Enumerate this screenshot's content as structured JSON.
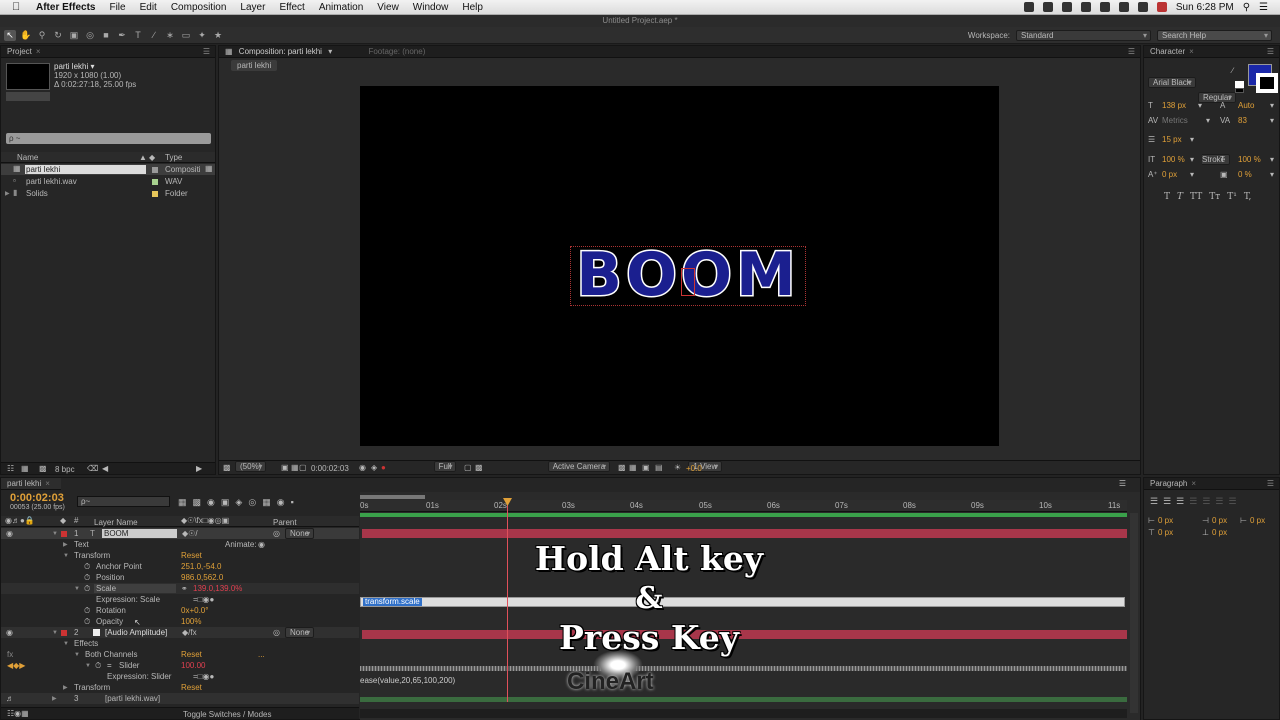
{
  "menubar": {
    "apple": "",
    "app": "After Effects",
    "items": [
      "File",
      "Edit",
      "Composition",
      "Layer",
      "Effect",
      "Animation",
      "View",
      "Window",
      "Help"
    ],
    "clock": "Sun 6:28 PM"
  },
  "title": "Untitled Project.aep *",
  "workspace": {
    "label": "Workspace:",
    "value": "Standard"
  },
  "search_help": "Search Help",
  "project": {
    "tab": "Project",
    "comp_name": "parti lekhi ▾",
    "comp_res": "1920 x 1080 (1.00)",
    "comp_dur": "Δ 0:02:27:18, 25.00 fps",
    "search_placeholder": "ρ ~",
    "col_name": "Name",
    "col_type": "Type",
    "items": [
      {
        "name": "parti lekhi",
        "type": "Compositi"
      },
      {
        "name": "parti lekhi.wav",
        "type": "WAV"
      },
      {
        "name": "Solids",
        "type": "Folder"
      }
    ],
    "bpc": "8 bpc"
  },
  "composition": {
    "tab": "Composition: parti lekhi",
    "footage": "Footage: (none)",
    "subtab": "parti lekhi",
    "text": "BOOM",
    "zoom": "(50%)",
    "timecode": "0:00:02:03",
    "resolution": "Full",
    "camera": "Active Camera",
    "view": "1 View",
    "exposure": "+0.0"
  },
  "character": {
    "tab": "Character",
    "font": "Arial Black",
    "style": "Regular",
    "size": "138 px",
    "leading": "Auto",
    "kerning": "Metrics",
    "tracking": "83",
    "stroke": "15 px",
    "stroke_mode": "Fill Over Stroke",
    "vscale": "100 %",
    "hscale": "100 %",
    "baseline": "0 px",
    "tsume": "0 %",
    "styles": [
      "T",
      "T",
      "TT",
      "Tт",
      "T¹",
      "T,"
    ]
  },
  "paragraph": {
    "tab": "Paragraph",
    "values": [
      "0 px",
      "0 px",
      "0 px",
      "0 px",
      "0 px"
    ]
  },
  "timeline": {
    "tab": "parti lekhi",
    "timecode": "0:00:02:03",
    "frames": "00053 (25.00 fps)",
    "search_placeholder": "ρ~",
    "col_layer": "Layer Name",
    "col_parent": "Parent",
    "rows": [
      {
        "label": "1",
        "name": "BOOM",
        "value": "",
        "parent": "None"
      },
      {
        "label": "",
        "name": "Text",
        "value": "",
        "extra": "Animate:"
      },
      {
        "label": "",
        "name": "Transform",
        "value": "Reset"
      },
      {
        "label": "",
        "name": "Anchor Point",
        "value": "251.0,-54.0"
      },
      {
        "label": "",
        "name": "Position",
        "value": "986.0,562.0"
      },
      {
        "label": "",
        "name": "Scale",
        "value": "139.0,139.0%"
      },
      {
        "label": "",
        "name": "Expression: Scale",
        "value": ""
      },
      {
        "label": "",
        "name": "Rotation",
        "value": "0x+0.0°"
      },
      {
        "label": "",
        "name": "Opacity",
        "value": "100%"
      },
      {
        "label": "2",
        "name": "[Audio Amplitude]",
        "value": "",
        "parent": "None"
      },
      {
        "label": "",
        "name": "Effects",
        "value": ""
      },
      {
        "label": "",
        "name": "Both Channels",
        "value": "Reset",
        "extra": "..."
      },
      {
        "label": "",
        "name": "Slider",
        "value": "100.00"
      },
      {
        "label": "",
        "name": "Expression: Slider",
        "value": ""
      },
      {
        "label": "",
        "name": "Transform",
        "value": "Reset"
      },
      {
        "label": "3",
        "name": "[parti lekhi.wav]",
        "value": ""
      }
    ],
    "ruler": [
      "0s",
      "01s",
      "02s",
      "03s",
      "04s",
      "05s",
      "06s",
      "07s",
      "08s",
      "09s",
      "10s",
      "11s"
    ],
    "expr_scale": "transform.scale",
    "expr_slider": "ease(value,20,65,100,200)",
    "toggle": "Toggle Switches / Modes"
  },
  "overlay": {
    "line1": "Hold Alt key",
    "line2": "&",
    "line3": "Press Key",
    "watermark": "CineArt"
  }
}
